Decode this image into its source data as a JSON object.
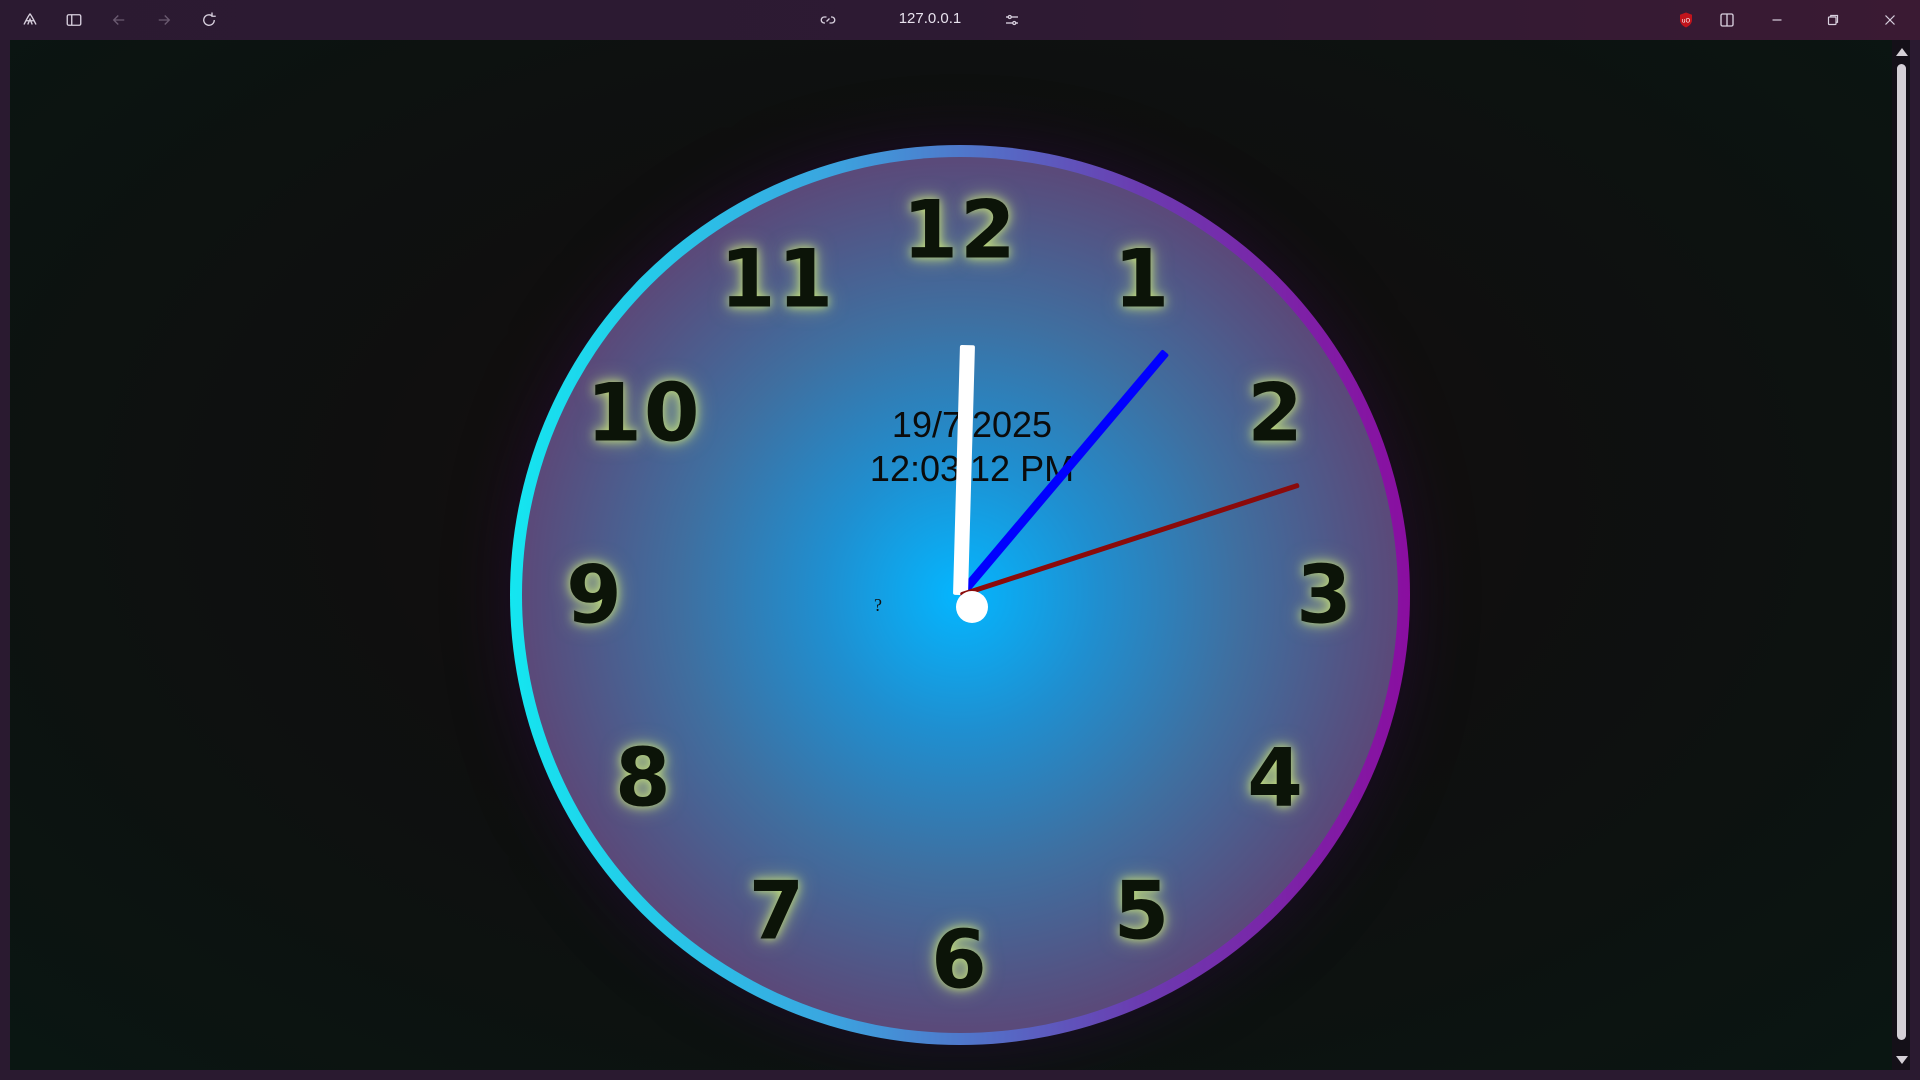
{
  "browser": {
    "url": "127.0.0.1",
    "icons": {
      "app": "browser-logo-icon",
      "sidebar": "sidebar-toggle-icon",
      "back": "back-arrow-icon",
      "forward": "forward-arrow-icon",
      "reload": "reload-icon",
      "link": "link-icon",
      "site_settings": "site-settings-icon",
      "extension": "ublock-origin-icon",
      "split": "split-view-icon",
      "minimize": "minimize-icon",
      "restore": "restore-icon",
      "close": "close-icon"
    }
  },
  "clock": {
    "numerals": [
      "12",
      "1",
      "2",
      "3",
      "4",
      "5",
      "6",
      "7",
      "8",
      "9",
      "10",
      "11"
    ],
    "date": "19/7/2025",
    "time": "12:03:12 PM",
    "extra_char": "?",
    "colors": {
      "hour_hand": "#ffffff",
      "minute_hand": "#0000ff",
      "second_hand": "#8b0a0a",
      "ring_start": "#14e6f0",
      "ring_end": "#8a0ea0",
      "numeral_glow": "#c6e27a"
    }
  }
}
